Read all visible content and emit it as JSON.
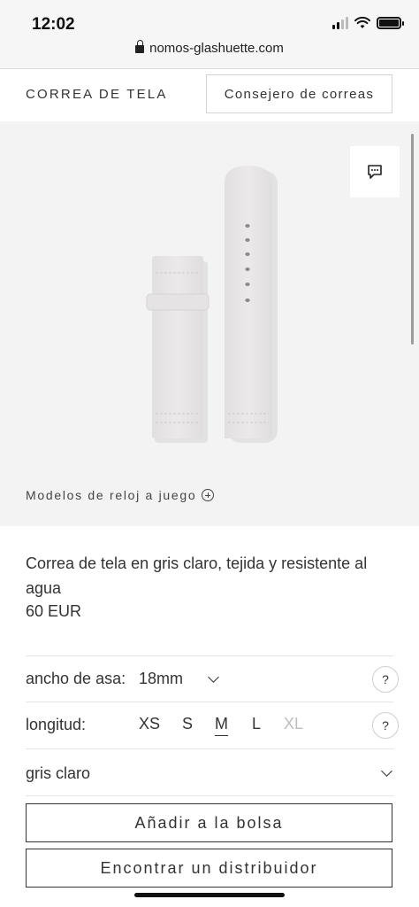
{
  "status_bar": {
    "time": "12:02",
    "url": "nomos-glashuette.com"
  },
  "subnav": {
    "title": "CORREA DE TELA",
    "advisor_label": "Consejero de correas"
  },
  "gallery": {
    "matching_label": "Modelos de reloj a juego",
    "strap_color": "#e9e6e7"
  },
  "product": {
    "description": "Correa de tela en gris claro, tejida y resistente al agua",
    "price": "60 EUR"
  },
  "options": {
    "lug_width_label": "ancho de asa:",
    "lug_width_value": "18mm",
    "length_label": "longitud:",
    "sizes": [
      {
        "label": "XS",
        "state": "available"
      },
      {
        "label": "S",
        "state": "available"
      },
      {
        "label": "M",
        "state": "selected"
      },
      {
        "label": "L",
        "state": "available"
      },
      {
        "label": "XL",
        "state": "disabled"
      }
    ],
    "color_value": "gris claro",
    "help_symbol": "?"
  },
  "actions": {
    "add_to_bag": "Añadir a la bolsa",
    "find_dealer": "Encontrar un distribuidor"
  },
  "icons": [
    "lock-icon",
    "signal-icon",
    "wifi-icon",
    "battery-icon",
    "chat-icon",
    "plus-circle-icon",
    "chevron-down-icon",
    "help-icon"
  ]
}
